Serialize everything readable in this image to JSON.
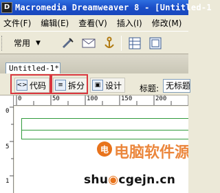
{
  "window": {
    "title": "Macromedia Dreamweaver 8 - [Untitled-1",
    "app_icon_label": "D"
  },
  "menu": {
    "items": [
      "文件(F)",
      "编辑(E)",
      "查看(V)",
      "插入(I)",
      "修改(M)"
    ]
  },
  "insert_bar": {
    "category": "常用",
    "icons": [
      "hyperlink-icon",
      "email-link-icon",
      "named-anchor-icon",
      "table-icon",
      "layer-icon"
    ]
  },
  "document": {
    "tab_label": "Untitled-1*",
    "view_buttons": {
      "code": "代码",
      "split": "拆分",
      "design": "设计"
    },
    "title_label": "标题:",
    "title_value": "无标题"
  },
  "rulers": {
    "h_ticks": [
      "0",
      "50",
      "100",
      "150",
      "200"
    ],
    "v_ticks": [
      "0",
      "5",
      "1"
    ]
  },
  "watermark": {
    "brand_cn": "电脑软件源",
    "url_prefix": "shu",
    "url_suffix": "cgejn.cn"
  },
  "colors": {
    "title_bar": "#1b4fc8",
    "highlight": "#d9363e",
    "guide_line": "#2f9a3a",
    "watermark_orange": "#e8731c"
  }
}
